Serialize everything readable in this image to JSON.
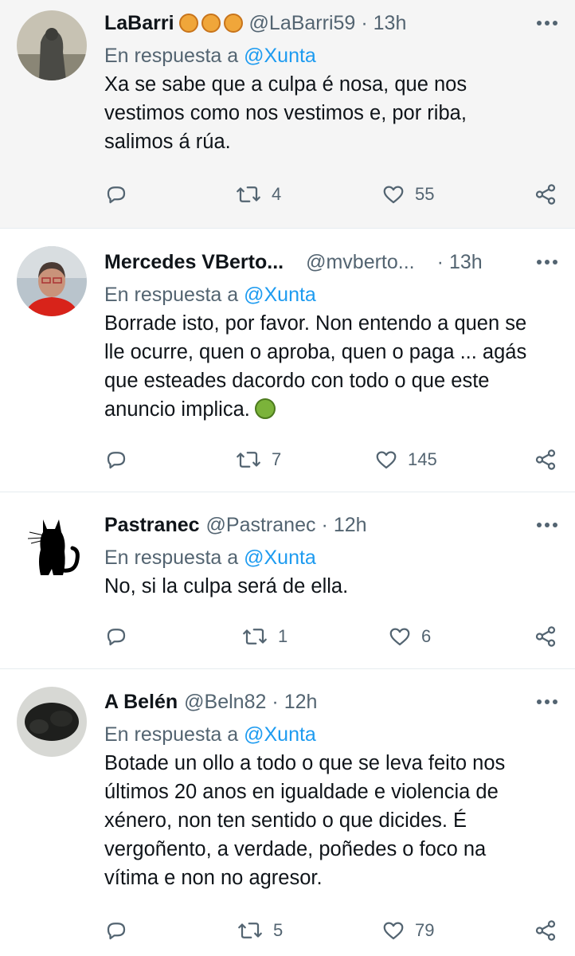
{
  "tweets": [
    {
      "name": "LaBarri",
      "handle": "@LaBarri59",
      "time": "13h",
      "reply_prefix": "En respuesta a",
      "reply_to": "@Xunta",
      "text_lines": [
        "Xa se sabe que a culpa é nosa, que nos",
        "vestimos como nos vestimos e, por riba,",
        "salimos á rúa."
      ],
      "retweets": "4",
      "likes": "55"
    },
    {
      "name": "Mercedes VBerto...",
      "handle": "@mvberto...",
      "time": "13h",
      "reply_prefix": "En respuesta a",
      "reply_to": "@Xunta",
      "text_lines": [
        "Borrade isto, por favor. Non entendo a quen se",
        "lle ocurre, quen o aproba, quen o paga ... agás",
        "que esteades dacordo con todo o que este",
        "anuncio implica."
      ],
      "retweets": "7",
      "likes": "145"
    },
    {
      "name": "Pastranec",
      "handle": "@Pastranec",
      "time": "12h",
      "reply_prefix": "En respuesta a",
      "reply_to": "@Xunta",
      "text_lines": [
        "No, si la culpa será de ella."
      ],
      "retweets": "1",
      "likes": "6"
    },
    {
      "name": "A Belén",
      "handle": "@Beln82",
      "time": "12h",
      "reply_prefix": "En respuesta a",
      "reply_to": "@Xunta",
      "text_lines": [
        "Botade un ollo a todo o que se leva feito nos",
        "últimos 20 anos en igualdade e violencia de",
        "xénero, non ten sentido o que dicides. É",
        "vergoñento, a verdade, poñedes o foco na",
        "vítima e non no agresor."
      ],
      "retweets": "5",
      "likes": "79"
    }
  ],
  "separator": "·",
  "icons": {
    "reply": "reply-icon",
    "retweet": "retweet-icon",
    "like": "like-icon",
    "share": "share-icon",
    "more": "more-icon",
    "lion_emoji": "lion-emoji",
    "nauseated_emoji": "nauseated-emoji"
  },
  "colors": {
    "link": "#1d9bf0",
    "secondary_text": "#536471",
    "highlight_bg": "#f5f5f5"
  }
}
